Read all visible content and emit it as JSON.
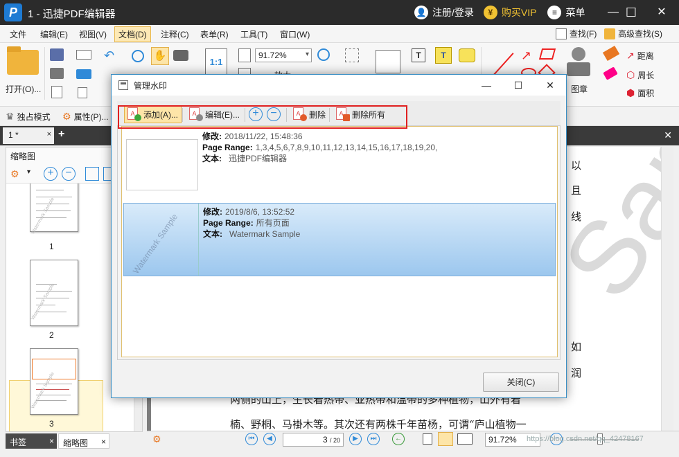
{
  "titlebar": {
    "title": "1 - 迅捷PDF编辑器",
    "login": "注册/登录",
    "vip": "购买VIP",
    "menu": "菜单",
    "minimize": "—",
    "maximize": "☐",
    "close": "✕"
  },
  "menubar": {
    "items": [
      "文件",
      "编辑(E)",
      "视图(V)",
      "文档(D)",
      "注释(C)",
      "表单(R)",
      "工具(T)",
      "窗口(W)"
    ],
    "find": "查找(F)",
    "advanced_find": "高级查找(S)"
  },
  "ribbon": {
    "open_label": "打开(O)...",
    "zoom_value": "91.72%",
    "zoom_label": "放大",
    "stamp_label": "图章",
    "measure": [
      "距离",
      "周长",
      "面积"
    ],
    "fit_label": "1:1"
  },
  "modebar": {
    "exclusive_mode": "独占模式",
    "properties": "属性(P)..."
  },
  "tabs": {
    "doc_tab": "1 *",
    "close": "×",
    "add": "+",
    "close_all": "✕"
  },
  "leftpanel": {
    "title": "缩略图",
    "thumbs": [
      {
        "num": "1",
        "wm": "Watermark Sample"
      },
      {
        "num": "2",
        "wm": "Watermark Sample"
      },
      {
        "num": "3",
        "wm": "Watermark Sample"
      }
    ],
    "bottom_tabs": [
      "书签",
      "缩略图"
    ],
    "tab_close": "×"
  },
  "document": {
    "watermark": "Sample",
    "lines": [
      "以",
      "且",
      "线",
      "如",
      "润",
      "两侧的山上，生长着热带、亚热带和温带的多种植物，山外有着",
      "楠、野桐、马褂木等。其次还有两株千年苗杨，可谓“庐山植物一"
    ]
  },
  "statusbar": {
    "page_current": "3",
    "page_total": "/ 20",
    "zoom": "91.72%"
  },
  "site_watermark": "https://blog.csdn.net/qq_42478167",
  "dialog": {
    "title": "管理水印",
    "toolbar": {
      "add": "添加(A)...",
      "edit": "编辑(E)...",
      "delete": "删除",
      "delete_all": "删除所有"
    },
    "rows": [
      {
        "modified_label": "修改:",
        "modified": "2018/11/22, 15:48:36",
        "range_label": "Page Range:",
        "range": "1,3,4,5,6,7,8,9,10,11,12,13,14,15,16,17,18,19,20,",
        "text_label": "文本:",
        "text": "迅捷PDF编辑器",
        "preview": ""
      },
      {
        "modified_label": "修改:",
        "modified": "2019/8/6, 13:52:52",
        "range_label": "Page Range:",
        "range": "所有页面",
        "text_label": "文本:",
        "text": "Watermark Sample",
        "preview": "Watermark Sample"
      }
    ],
    "close_button": "关闭(C)"
  }
}
